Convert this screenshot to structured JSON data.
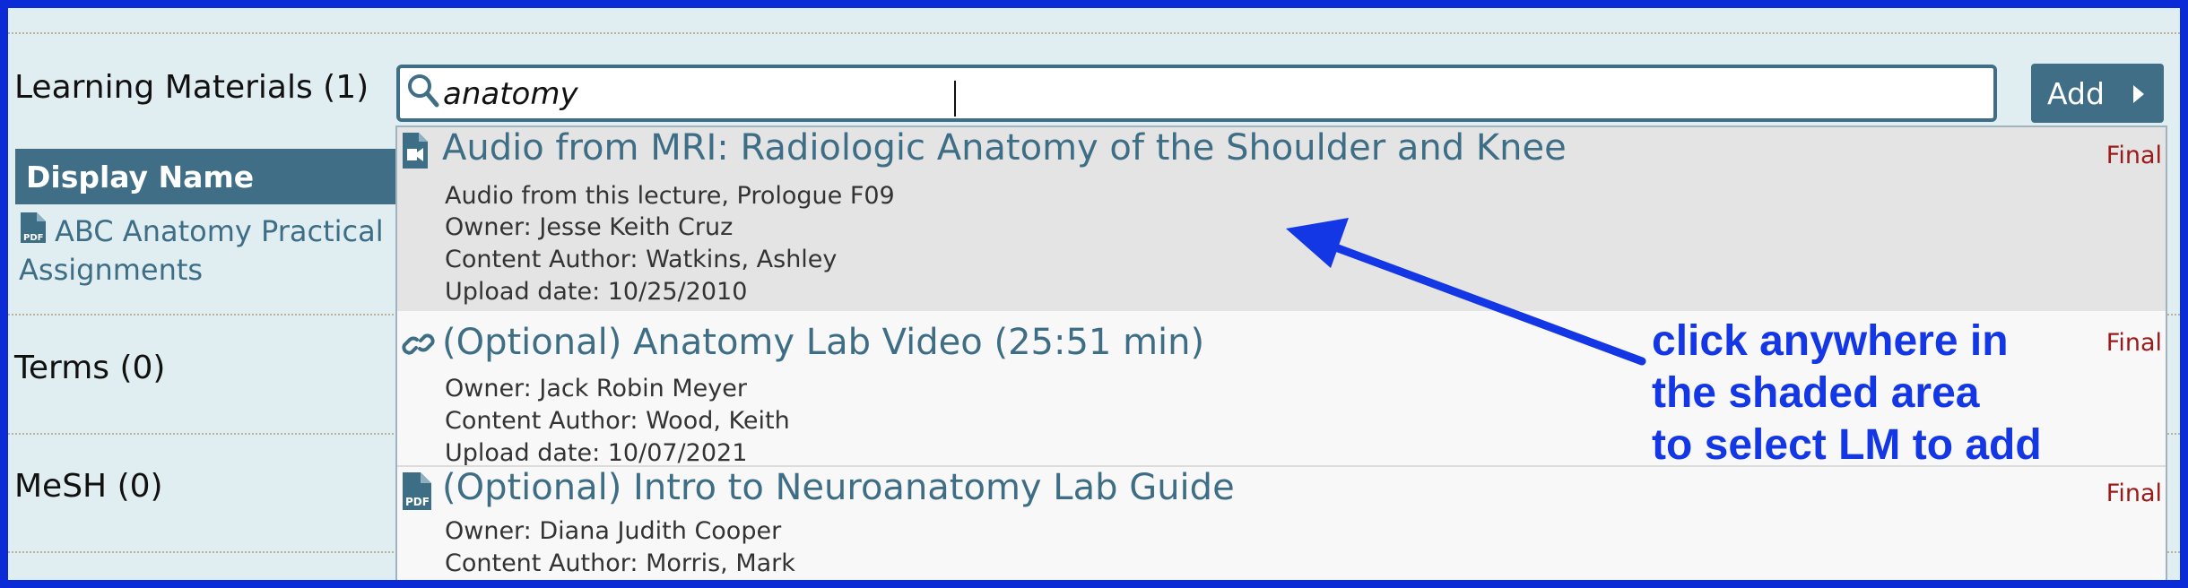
{
  "sections": {
    "learning_materials": "Learning Materials (1)",
    "terms": "Terms (0)",
    "mesh": "MeSH (0)"
  },
  "lm_table": {
    "header": "Display Name",
    "row": {
      "title_line1": "ABC Anatomy Practical",
      "title_line2": "Assignments",
      "icon": "pdf-file-icon"
    }
  },
  "search": {
    "value": "anatomy",
    "icon": "search-icon"
  },
  "add_button": {
    "label": "Add",
    "icon": "caret-right-icon"
  },
  "results": [
    {
      "icon": "audio-file-icon",
      "title": "Audio from MRI: Radiologic Anatomy of the Shoulder and Knee",
      "description": "Audio from this lecture, Prologue F09",
      "owner": "Owner: Jesse Keith Cruz",
      "author": "Content Author: Watkins, Ashley",
      "upload_date": "Upload date: 10/25/2010",
      "status": "Final"
    },
    {
      "icon": "link-icon",
      "title": "(Optional) Anatomy Lab Video (25:51 min)",
      "owner": "Owner: Jack Robin Meyer",
      "author": "Content Author: Wood, Keith",
      "upload_date": "Upload date: 10/07/2021",
      "status": "Final"
    },
    {
      "icon": "pdf-file-icon",
      "title": "(Optional) Intro to Neuroanatomy Lab Guide",
      "owner": "Owner: Diana Judith Cooper",
      "author": "Content Author: Morris, Mark",
      "status": "Final"
    }
  ],
  "annotation": {
    "line1": "click anywhere in",
    "line2": "the shaded area",
    "line3": "to select LM to add"
  },
  "colors": {
    "frame_border": "#0b2bd6",
    "background": "#e0eef1",
    "accent": "#3f6e86",
    "status": "#9b1a1a",
    "annotation": "#1437e6",
    "highlight": "#e4e4e4"
  }
}
